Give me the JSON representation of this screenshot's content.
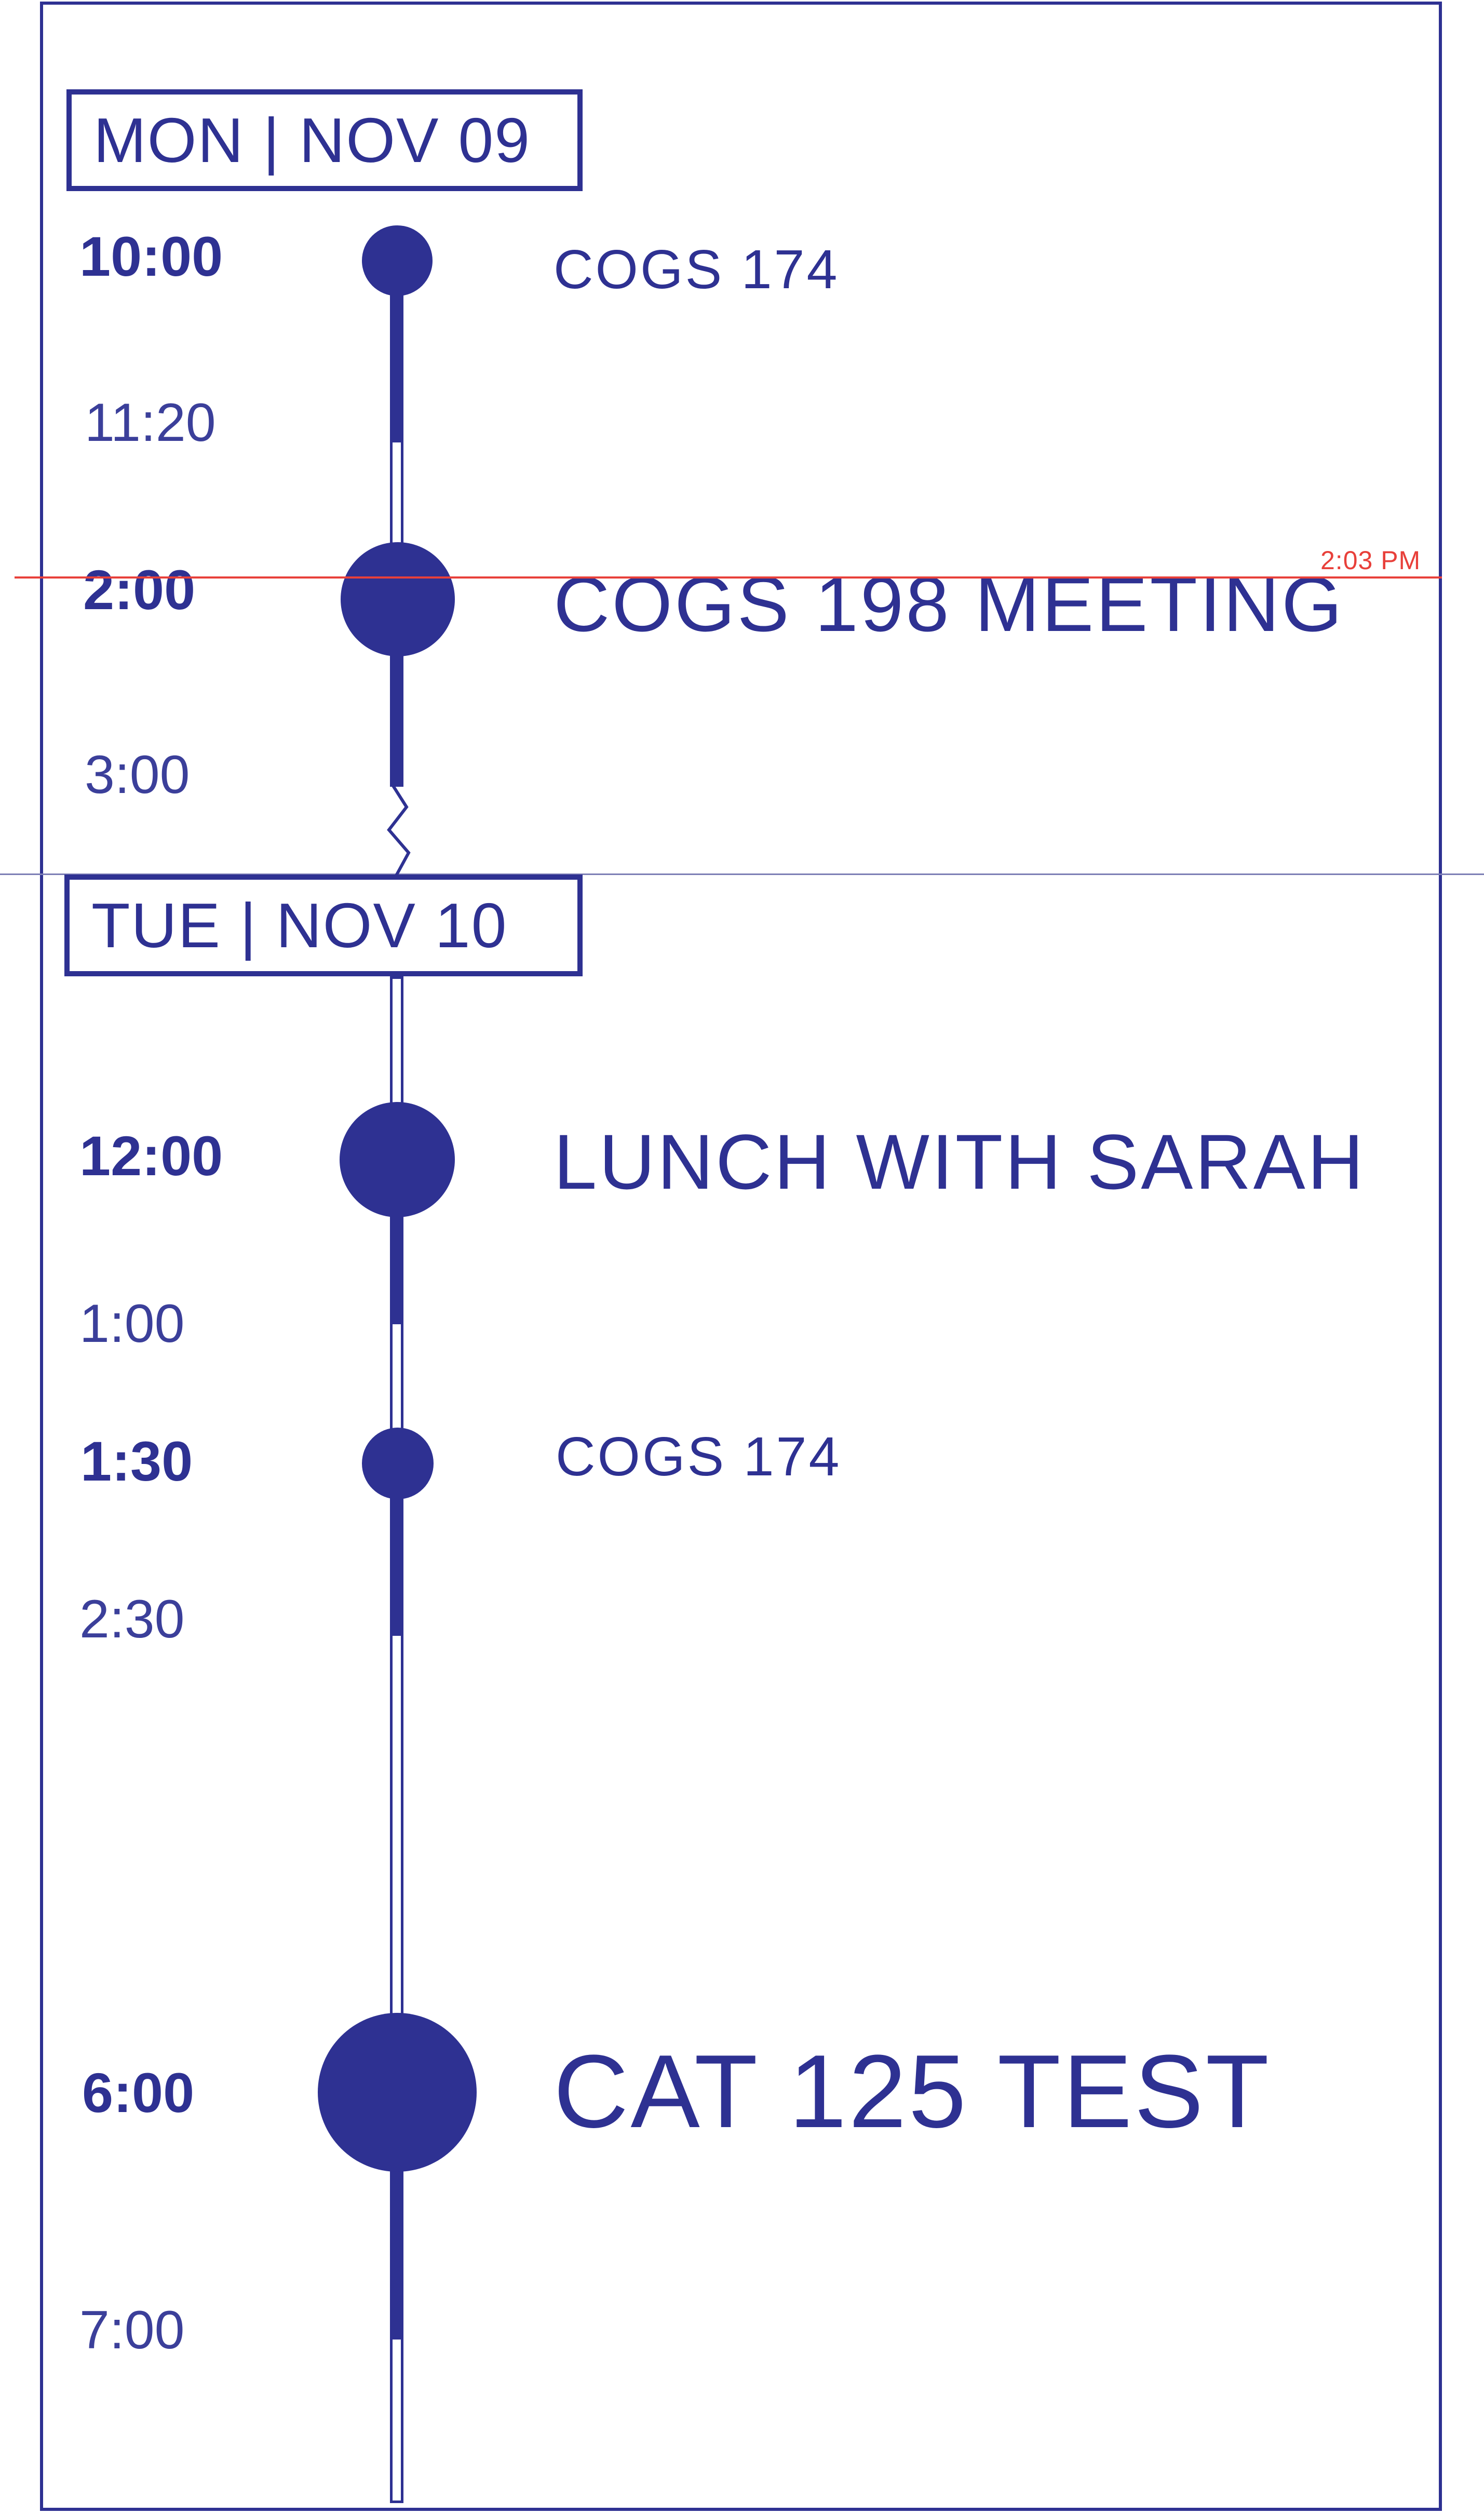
{
  "now_indicator": {
    "label": "2:03 PM",
    "color": "#e8403a"
  },
  "theme": {
    "accent": "#2e3192",
    "background": "#ffffff"
  },
  "days": [
    {
      "date_label": "MON | NOV 09",
      "events": [
        {
          "start": "10:00",
          "end": "11:20",
          "title": "COGS 174"
        },
        {
          "start": "2:00",
          "end": "3:00",
          "title": "COGS 198 MEETING"
        }
      ]
    },
    {
      "date_label": "TUE | NOV 10",
      "events": [
        {
          "start": "12:00",
          "end": "1:00",
          "title": "LUNCH WITH SARAH"
        },
        {
          "start": "1:30",
          "end": "2:30",
          "title": "COGS 174"
        },
        {
          "start": "6:00",
          "end": "7:00",
          "title": "CAT 125 TEST"
        }
      ]
    }
  ]
}
